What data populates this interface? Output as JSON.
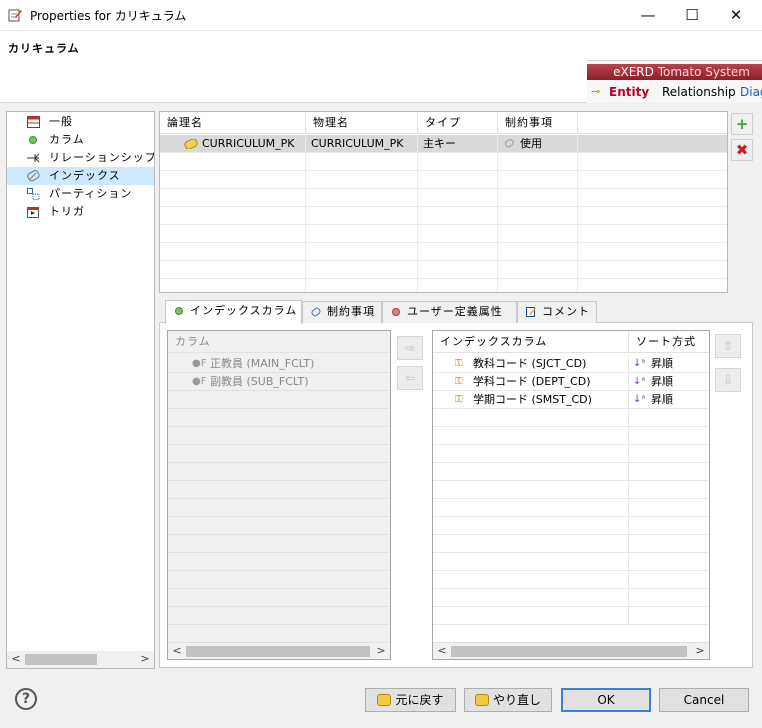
{
  "window": {
    "title": "Properties for カリキュラム",
    "minimize": "—",
    "maximize": "☐",
    "close": "✕"
  },
  "header": {
    "entity_name": "カリキュラム",
    "brand_name": "eXERD",
    "brand_sub": "Tomato System",
    "tabs": [
      "Entity",
      "Relationship",
      "Diag"
    ]
  },
  "tree": {
    "items": [
      {
        "label": "一般",
        "icon": "table-icon"
      },
      {
        "label": "カラム",
        "icon": "column-icon"
      },
      {
        "label": "リレーションシップ",
        "icon": "relation-icon"
      },
      {
        "label": "インデックス",
        "icon": "index-icon",
        "selected": true
      },
      {
        "label": "パーティション",
        "icon": "partition-icon"
      },
      {
        "label": "トリガ",
        "icon": "trigger-icon"
      }
    ],
    "scroll_left": "<",
    "scroll_right": ">"
  },
  "index_table": {
    "headers": [
      "論理名",
      "物理名",
      "タイプ",
      "制約事項"
    ],
    "rows": [
      {
        "logical": "CURRICULUM_PK",
        "physical": "CURRICULUM_PK",
        "type": "主キー",
        "constraint": "使用"
      }
    ]
  },
  "side_buttons": {
    "add": "+",
    "remove": "✖"
  },
  "tabs": [
    {
      "label": "インデックスカラム",
      "icon": "circle-green-icon",
      "active": true
    },
    {
      "label": "制約事項",
      "icon": "constraint-icon"
    },
    {
      "label": "ユーザー定義属性",
      "icon": "circle-red-icon"
    },
    {
      "label": "コメント",
      "icon": "comment-icon"
    }
  ],
  "columns_panel": {
    "header": "カラム",
    "items": [
      "正教員 (MAIN_FCLT)",
      "副教員 (SUB_FCLT)"
    ]
  },
  "index_columns_panel": {
    "headers": [
      "インデックスカラム",
      "ソート方式"
    ],
    "rows": [
      {
        "name": "教科コード (SJCT_CD)",
        "sort": "昇順"
      },
      {
        "name": "学科コード (DEPT_CD)",
        "sort": "昇順"
      },
      {
        "name": "学期コード (SMST_CD)",
        "sort": "昇順"
      }
    ]
  },
  "move_buttons": {
    "add": "⇨",
    "remove": "⇦",
    "up": "⇧",
    "down": "⇩"
  },
  "footer": {
    "help": "?",
    "undo": "元に戻す",
    "redo": "やり直し",
    "ok": "OK",
    "cancel": "Cancel"
  },
  "colors": {
    "selection": "#cde8ff",
    "brand": "#a0303a",
    "ok_border": "#3c7fd9"
  }
}
